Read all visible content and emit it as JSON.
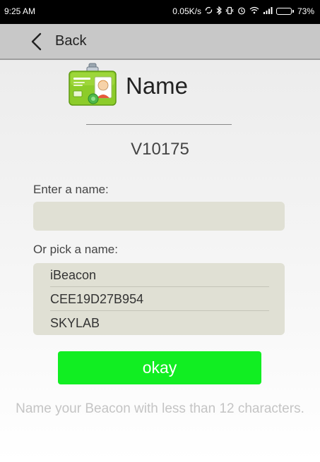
{
  "status_bar": {
    "time": "9:25 AM",
    "speed": "0.05K/s",
    "battery_percent": "73%",
    "battery_level": 0.73,
    "icons": [
      "sync-icon",
      "bluetooth-icon",
      "vibrate-icon",
      "alarm-icon",
      "wifi-icon",
      "signal-icon",
      "battery-icon"
    ]
  },
  "nav": {
    "back_label": "Back"
  },
  "header": {
    "title": "Name",
    "device_id": "V10175"
  },
  "form": {
    "enter_label": "Enter a name:",
    "input_value": "",
    "input_placeholder": "",
    "pick_label": "Or pick a name:",
    "options": [
      {
        "label": "iBeacon"
      },
      {
        "label": "CEE19D27B954"
      },
      {
        "label": "SKYLAB"
      }
    ],
    "okay_label": "okay",
    "hint": "Name your Beacon with less than 12 characters."
  },
  "colors": {
    "okay_button": "#11ee22",
    "field_background": "#e0e0d4",
    "nav_background": "#c8c8c8"
  }
}
